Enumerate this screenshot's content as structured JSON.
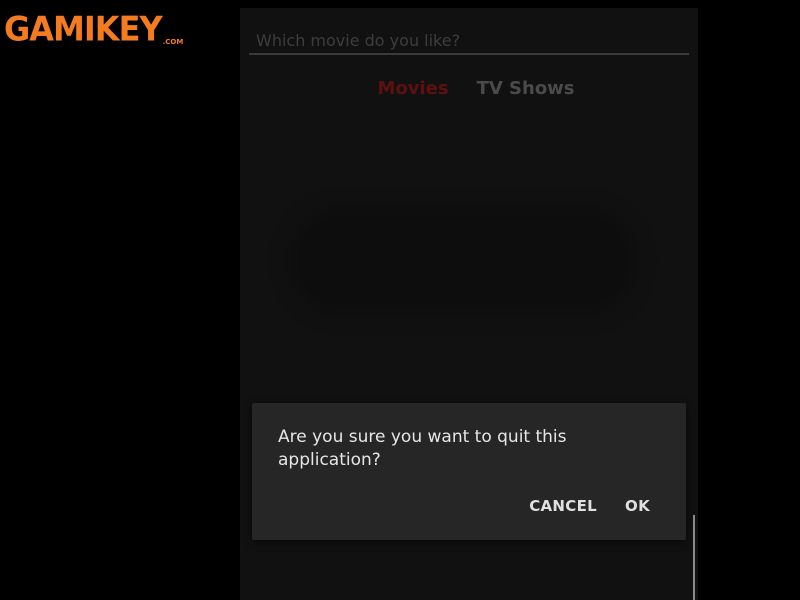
{
  "watermark": {
    "text": "GAMIKEY",
    "suffix": ".COM",
    "color": "#f47b20"
  },
  "search": {
    "placeholder": "Which movie do you like?"
  },
  "tabs": [
    {
      "label": "Movies",
      "active": true,
      "color": "#5e1010"
    },
    {
      "label": "TV Shows",
      "active": false,
      "color": "#4a4a4a"
    }
  ],
  "dialog": {
    "message": "Are you sure you want to quit this application?",
    "cancel_label": "CANCEL",
    "ok_label": "OK"
  }
}
